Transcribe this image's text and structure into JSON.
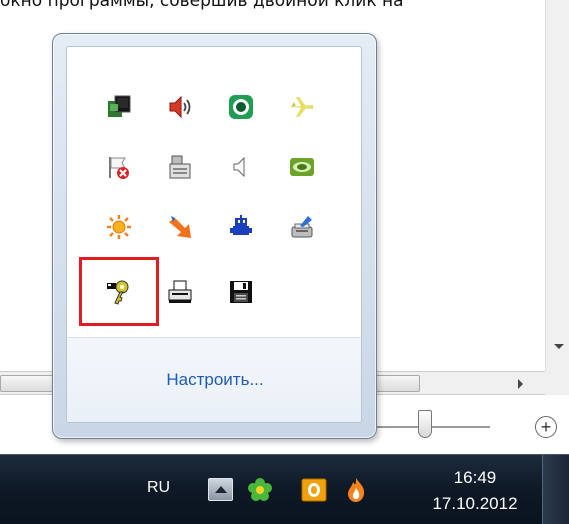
{
  "top_text": "окно программы, совершив двойной клик на",
  "tray_popup": {
    "customize_link": "Настроить...",
    "icons": [
      {
        "name": "network-icon"
      },
      {
        "name": "volume-icon"
      },
      {
        "name": "green-circle-app-icon"
      },
      {
        "name": "airplane-icon"
      },
      {
        "name": "action-center-flag-error-icon"
      },
      {
        "name": "device-removable-icon"
      },
      {
        "name": "speaker-muted-icon"
      },
      {
        "name": "nvidia-icon"
      },
      {
        "name": "sun-brightness-icon"
      },
      {
        "name": "orange-arrow-icon"
      },
      {
        "name": "bluetooth-robot-icon"
      },
      {
        "name": "printer-brush-icon"
      },
      {
        "name": "keys-icon"
      },
      {
        "name": "printer-icon"
      },
      {
        "name": "floppy-disk-icon"
      }
    ]
  },
  "taskbar": {
    "language": "RU",
    "time": "16:49",
    "date": "17.10.2012",
    "tray_icons": [
      {
        "name": "icq-flower-icon"
      },
      {
        "name": "outlook-icon"
      },
      {
        "name": "flame-icon"
      }
    ]
  },
  "colors": {
    "highlight": "#e31b23",
    "link": "#1e5cb3",
    "taskbar": "#0e1926"
  }
}
